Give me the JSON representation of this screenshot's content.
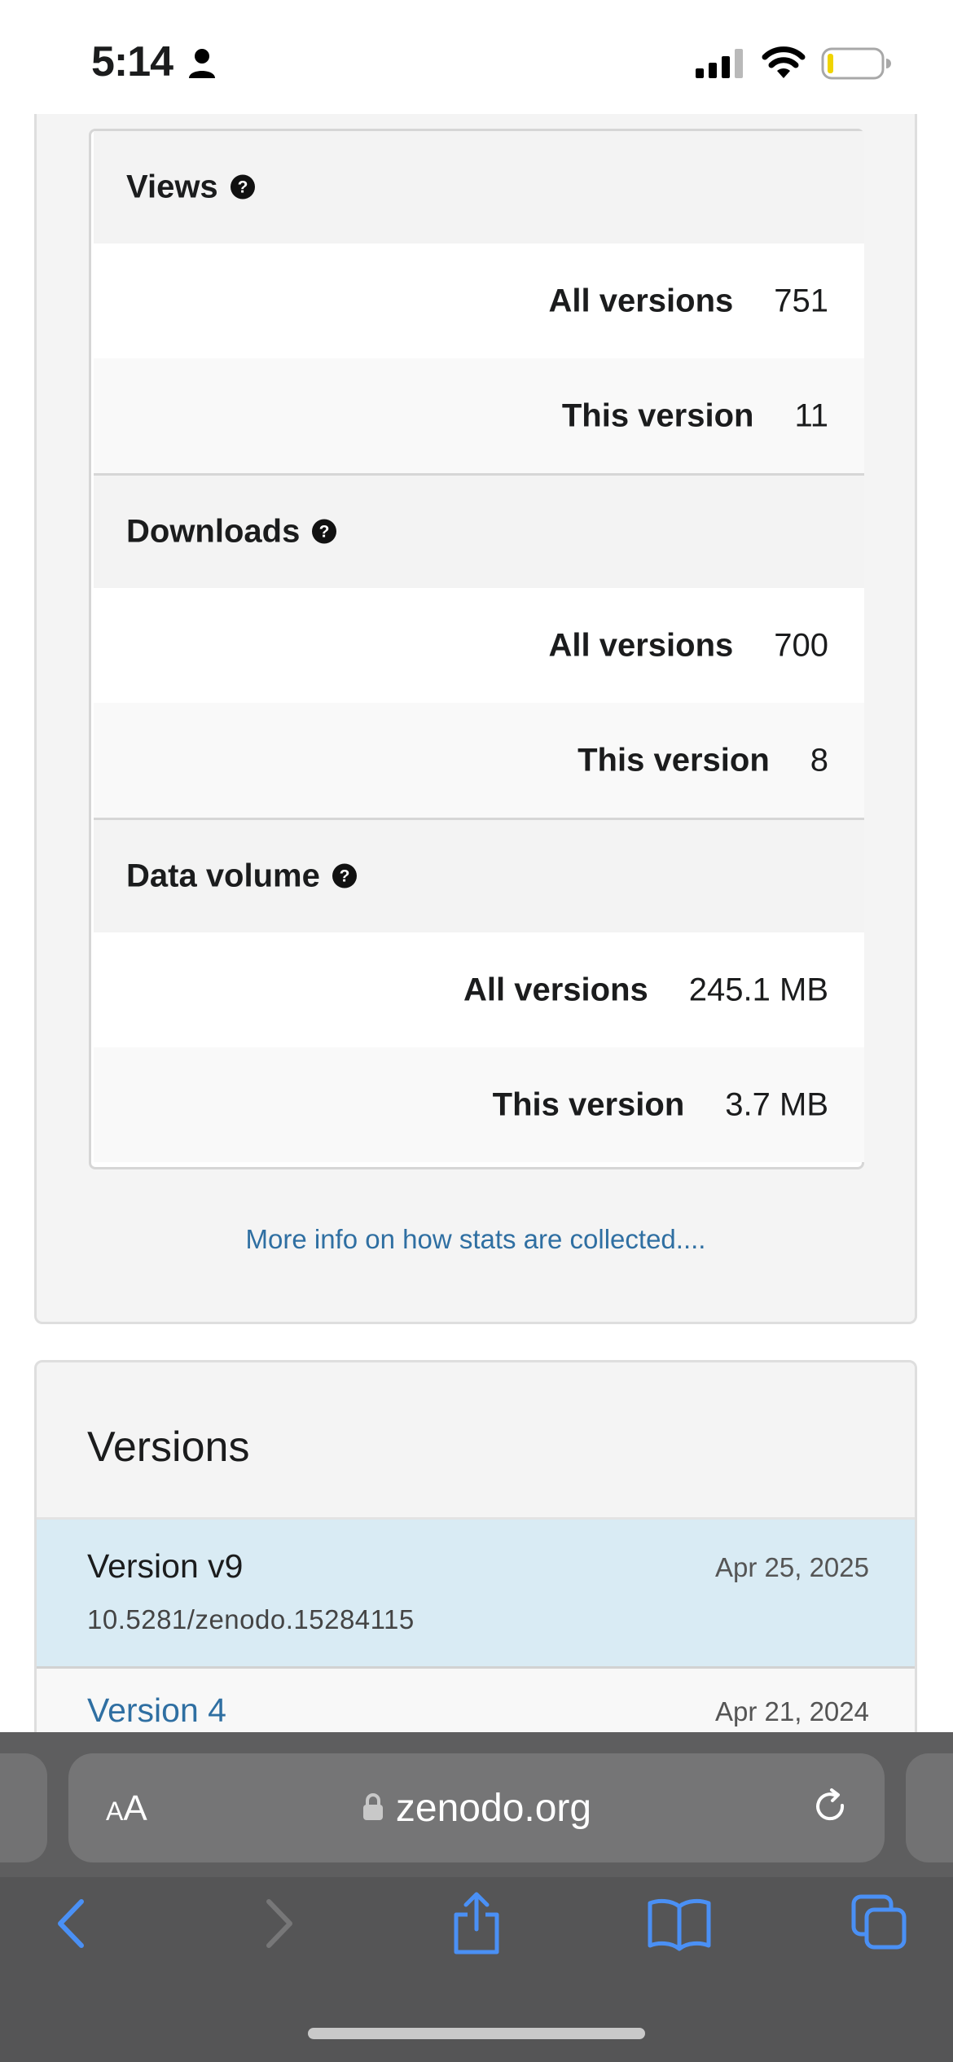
{
  "status_bar": {
    "time": "5:14",
    "icons": [
      "person-icon",
      "cellular-signal-icon",
      "wifi-icon",
      "battery-low-icon"
    ]
  },
  "stats": {
    "views": {
      "label": "Views",
      "all_versions_label": "All versions",
      "all_versions_value": "751",
      "this_version_label": "This version",
      "this_version_value": "11"
    },
    "downloads": {
      "label": "Downloads",
      "all_versions_label": "All versions",
      "all_versions_value": "700",
      "this_version_label": "This version",
      "this_version_value": "8"
    },
    "data_volume": {
      "label": "Data volume",
      "all_versions_label": "All versions",
      "all_versions_value": "245.1 MB",
      "this_version_label": "This version",
      "this_version_value": "3.7 MB"
    },
    "more_info_link": "More info on how stats are collected...."
  },
  "versions": {
    "title": "Versions",
    "items": [
      {
        "name": "Version v9",
        "doi": "10.5281/zenodo.15284115",
        "date": "Apr 25, 2025",
        "active": true
      },
      {
        "name": "Version 4",
        "date": "Apr 21, 2024",
        "active": false
      }
    ]
  },
  "browser": {
    "text_size_button": {
      "small": "A",
      "large": "A"
    },
    "url": "zenodo.org",
    "toolbar": [
      "back-icon",
      "forward-icon",
      "share-icon",
      "bookmarks-icon",
      "tabs-icon"
    ]
  },
  "colors": {
    "link": "#2f6fa2",
    "active_version_bg": "#d9ebf4",
    "safari_accent": "#4a90f5",
    "chrome_bg": "#555556"
  }
}
